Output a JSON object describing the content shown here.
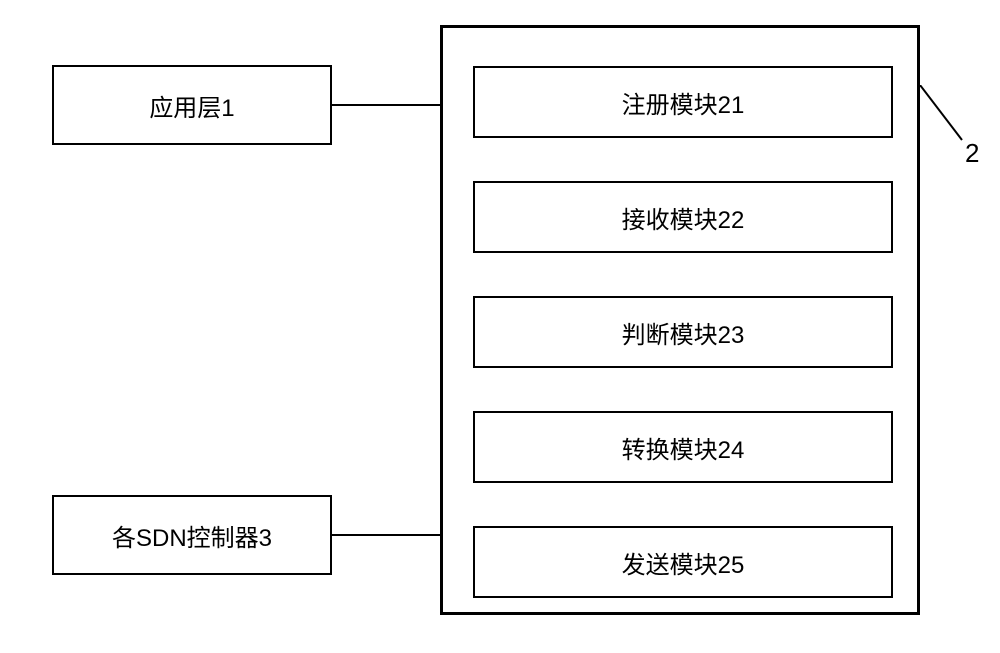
{
  "left": {
    "box1": "应用层1",
    "box2": "各SDN控制器3"
  },
  "container": {
    "label": "2",
    "modules": [
      "注册模块21",
      "接收模块22",
      "判断模块23",
      "转换模块24",
      "发送模块25"
    ]
  }
}
